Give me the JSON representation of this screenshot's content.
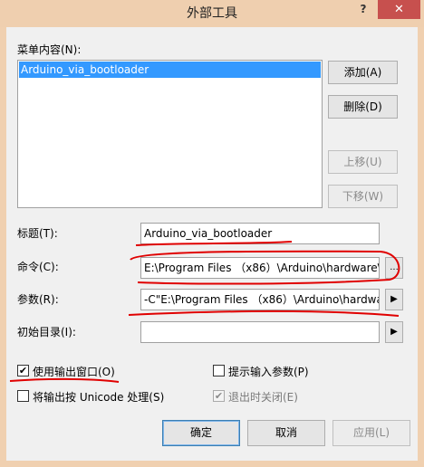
{
  "window": {
    "title": "外部工具",
    "help_glyph": "?",
    "close_glyph": "✕"
  },
  "menu_contents": {
    "label": "菜单内容(N):",
    "items": [
      "Arduino_via_bootloader"
    ]
  },
  "buttons": {
    "add": "添加(A)",
    "delete": "删除(D)",
    "move_up": "上移(U)",
    "move_down": "下移(W)",
    "ok": "确定",
    "cancel": "取消",
    "apply": "应用(L)"
  },
  "fields": {
    "title_label": "标题(T):",
    "title_value": "Arduino_via_bootloader",
    "command_label": "命令(C):",
    "command_value": "E:\\Program Files （x86）\\Arduino\\hardware\\",
    "command_browse": "...",
    "args_label": "参数(R):",
    "args_value": "-C\"E:\\Program Files （x86）\\Arduino\\hardware\\",
    "args_arrow": "▶",
    "initdir_label": "初始目录(I):",
    "initdir_value": "",
    "initdir_arrow": "▶"
  },
  "checkboxes": {
    "use_output_window": {
      "label": "使用输出窗口(O)",
      "checked": true,
      "mark": "✔"
    },
    "prompt_arguments": {
      "label": "提示输入参数(P)",
      "checked": false,
      "mark": ""
    },
    "treat_unicode": {
      "label": "将输出按 Unicode 处理(S)",
      "checked": false,
      "mark": ""
    },
    "close_on_exit": {
      "label": "退出时关闭(E)",
      "checked": true,
      "mark": "✔"
    }
  },
  "colors": {
    "accent": "#3399ff",
    "titlebar": "#efcfaf",
    "close": "#c7504e",
    "annotation": "#e00000"
  }
}
